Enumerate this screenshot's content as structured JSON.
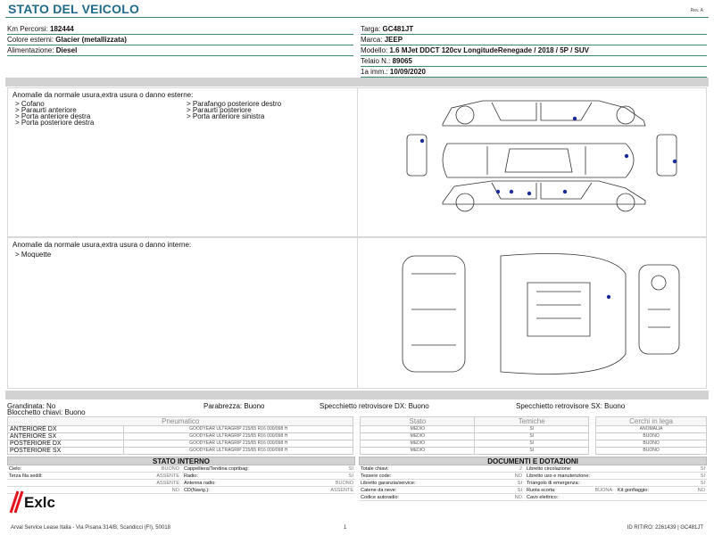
{
  "header": {
    "title": "STATO DEL VEICOLO",
    "rev": "Rev. A"
  },
  "vehicle": {
    "km_label": "Km Percorsi:",
    "km_value": "182444",
    "color_label": "Colore esterni:",
    "color_value": "Glacier (metallizzata)",
    "fuel_label": "Alimentazione:",
    "fuel_value": "Diesel",
    "plate_label": "Targa:",
    "plate_value": "GC481JT",
    "brand_label": "Marca:",
    "brand_value": "JEEP",
    "model_label": "Modello:",
    "model_value": "1.6 MJet DDCT 120cv LongitudeRenegade / 2018 / 5P / SUV",
    "chassis_label": "Telaio N.:",
    "chassis_value": "89065",
    "reg_label": "1a imm.:",
    "reg_value": "10/09/2020"
  },
  "external": {
    "title": "Anomalie da normale usura,extra usura o danno esterne:",
    "col1": [
      "> Cofano",
      "> Paraurti anteriore",
      "> Porta anteriore destra",
      "> Porta posteriore destra"
    ],
    "col2": [
      "> Parafango posteriore destro",
      "> Paraurti posteriore",
      "> Porta anteriore sinistra"
    ]
  },
  "internal": {
    "title": "Anomalie da normale usura,extra usura o danno interne:",
    "items": [
      "> Moquette"
    ]
  },
  "status": {
    "grandinata": "Grandinata: No",
    "parabrezza": "Parabrezza: Buono",
    "spec_dx": "Specchietto retrovisore DX: Buono",
    "spec_sx": "Specchietto retrovisore SX: Buono",
    "blocchetto": "Blocchetto chiavi: Buono"
  },
  "tyres": {
    "headers": [
      "Pneumatico",
      "Stato",
      "Temiche",
      "Cerchi in lega"
    ],
    "rows": [
      {
        "pos": "ANTERIORE DX",
        "desc": "GOODYEAR ULTRAGRIP 215/65 R16 000/098 H",
        "stato": "MEDIO",
        "termiche": "SI",
        "cerchi": "ANOMALIA"
      },
      {
        "pos": "ANTERIORE SX",
        "desc": "GOODYEAR ULTRAGRIP 215/65 R16 000/098 H",
        "stato": "MEDIO",
        "termiche": "SI",
        "cerchi": "BUONO"
      },
      {
        "pos": "POSTERIORE DX",
        "desc": "GOODYEAR ULTRAGRIP 215/65 R16 000/098 H",
        "stato": "MEDIO",
        "termiche": "SI",
        "cerchi": "BUONO"
      },
      {
        "pos": "POSTERIORE SX",
        "desc": "GOODYEAR ULTRAGRIP 215/65 R16 000/098 H",
        "stato": "MEDIO",
        "termiche": "SI",
        "cerchi": "BUONO"
      }
    ]
  },
  "interior": {
    "title": "STATO INTERNO",
    "rows": [
      {
        "l1": "Cielo:",
        "v1": "BUONO",
        "l2": "Cappelliera/Tendina copribag:",
        "v2": "SI"
      },
      {
        "l1": "Terza fila sedili:",
        "v1": "ASSENTE",
        "l2": "Radio:",
        "v2": "SI"
      },
      {
        "l1": "",
        "v1": "ASSENTE",
        "l2": "Antenna radio:",
        "v2": "BUONO"
      },
      {
        "l1": "",
        "v1": "NO",
        "l2": "CD(Navig.):",
        "v2": "ASSENTE"
      }
    ]
  },
  "documents": {
    "title": "DOCUMENTI E DOTAZIONI",
    "rows": [
      {
        "l1": "Totale chiavi:",
        "v1": "2",
        "l2": "Libretto circolazione:",
        "v2": "SI"
      },
      {
        "l1": "Tessere code:",
        "v1": "NO",
        "l2": "Libretto uso e manutenzione:",
        "v2": "SI"
      },
      {
        "l1": "Libretto garanzia/service:",
        "v1": "SI",
        "l2": "Triangolo di emergenza:",
        "v2": "SI"
      },
      {
        "l1": "Catene da neve:",
        "v1": "SI",
        "l2": "Ruota scorta:",
        "v2": "BUONA",
        "l3": "Kit gonfiaggio:",
        "v3": "NO"
      },
      {
        "l1": "Codice autoradio:",
        "v1": "NO",
        "l2": "Cavo elettrico:",
        "v2": ""
      }
    ]
  },
  "logo": {
    "text": "Exlc"
  },
  "footer": {
    "address": "Arval Service Lease Italia - Via Pisana 314/B, Scandicci (FI), 50018",
    "page": "1",
    "id": "ID RITIRO: 2261439 | GC481JT"
  }
}
